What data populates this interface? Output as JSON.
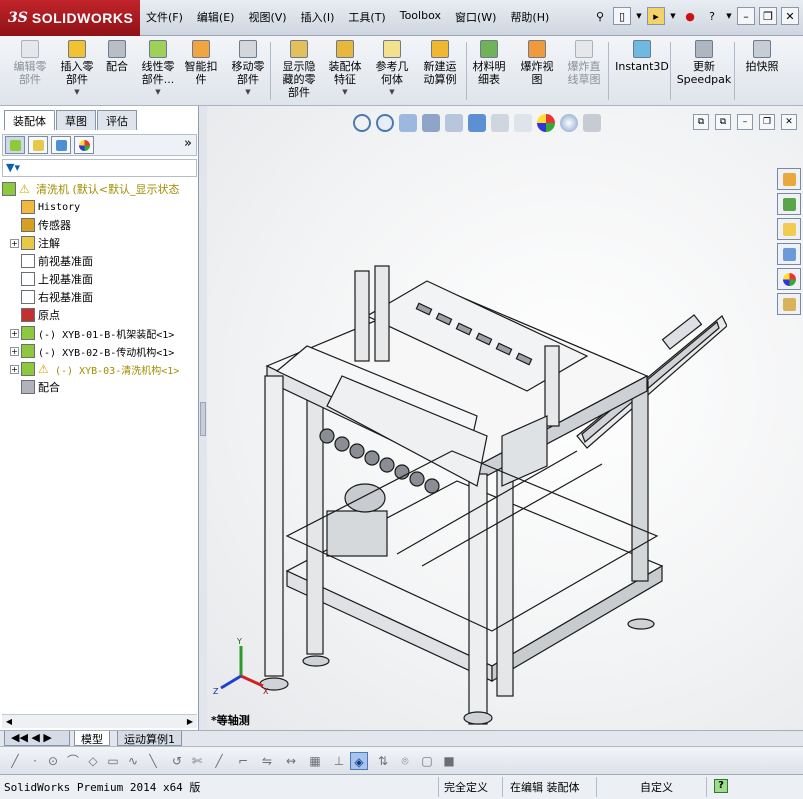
{
  "app": {
    "brand_ds": "3S",
    "brand_name": "SOLIDWORKS"
  },
  "menu": [
    "文件(F)",
    "编辑(E)",
    "视图(V)",
    "插入(I)",
    "工具(T)",
    "Toolbox",
    "窗口(W)",
    "帮助(H)"
  ],
  "toolbar": [
    {
      "label": "编辑零\n部件",
      "enabled": false,
      "color": "#d8d8d8"
    },
    {
      "label": "插入零\n部件",
      "enabled": true,
      "color": "#f2c230",
      "dropdown": true
    },
    {
      "label": "配合",
      "enabled": true,
      "color": "#b9bdc4"
    },
    {
      "label": "线性零\n部件...",
      "enabled": true,
      "color": "#9fd05a",
      "dropdown": true
    },
    {
      "label": "智能扣\n件",
      "enabled": true,
      "color": "#f0a540"
    },
    {
      "label": "移动零\n部件",
      "enabled": true,
      "color": "#d3d6da",
      "dropdown": true
    },
    {
      "label": "显示隐\n藏的零\n部件",
      "enabled": true,
      "color": "#e2c15a"
    },
    {
      "label": "装配体\n特征",
      "enabled": true,
      "color": "#e8b83c",
      "dropdown": true
    },
    {
      "label": "参考几\n何体",
      "enabled": true,
      "color": "#f4e18c",
      "dropdown": true
    },
    {
      "label": "新建运\n动算例",
      "enabled": true,
      "color": "#f0b830"
    },
    {
      "label": "材料明\n细表",
      "enabled": true,
      "color": "#6fb257"
    },
    {
      "label": "爆炸视\n图",
      "enabled": true,
      "color": "#f09a3c"
    },
    {
      "label": "爆炸直\n线草图",
      "enabled": false,
      "color": "#d8d8d8"
    },
    {
      "label": "Instant3D",
      "enabled": true,
      "color": "#6fb8e0"
    },
    {
      "label": "更新\nSpeedpak",
      "enabled": true,
      "color": "#b0b6bf"
    },
    {
      "label": "拍快照",
      "enabled": true,
      "color": "#c8ccd3"
    }
  ],
  "tabs": [
    "装配体",
    "草图",
    "评估"
  ],
  "tree": {
    "root": "清洗机  (默认<默认_显示状态",
    "items": [
      {
        "label": "History",
        "icon": "history-icon",
        "color": "#f4b840",
        "mono": true,
        "expander": false
      },
      {
        "label": "传感器",
        "icon": "sensor-icon",
        "color": "#d8a020",
        "expander": false
      },
      {
        "label": "注解",
        "icon": "annotation-icon",
        "color": "#e8c848",
        "expander": true
      },
      {
        "label": "前视基准面",
        "icon": "plane-icon",
        "color": "#ffffff",
        "expander": false
      },
      {
        "label": "上视基准面",
        "icon": "plane-icon",
        "color": "#ffffff",
        "expander": false
      },
      {
        "label": "右视基准面",
        "icon": "plane-icon",
        "color": "#ffffff",
        "expander": false
      },
      {
        "label": "原点",
        "icon": "origin-icon",
        "color": "#c43030",
        "expander": false
      },
      {
        "label": "(-) XYB-01-B-机架装配<1>",
        "icon": "assembly-icon",
        "color": "#8ec83c",
        "mono": true,
        "expander": true
      },
      {
        "label": "(-) XYB-02-B-传动机构<1>",
        "icon": "assembly-icon",
        "color": "#8ec83c",
        "mono": true,
        "expander": true
      },
      {
        "label": "(-) XYB-03-清洗机构<1>",
        "icon": "warning-assembly-icon",
        "color": "#8ec83c",
        "mono": true,
        "expander": true,
        "warn": true
      },
      {
        "label": "配合",
        "icon": "mate-icon",
        "color": "#b0b4ba",
        "expander": false
      }
    ]
  },
  "view": {
    "orientation": "*等轴测"
  },
  "bottom_tabs": [
    "模型",
    "运动算例1"
  ],
  "status": {
    "app_version": "SolidWorks Premium 2014 x64 版",
    "state": "完全定义",
    "mode": "在编辑 装配体",
    "units": "自定义"
  }
}
